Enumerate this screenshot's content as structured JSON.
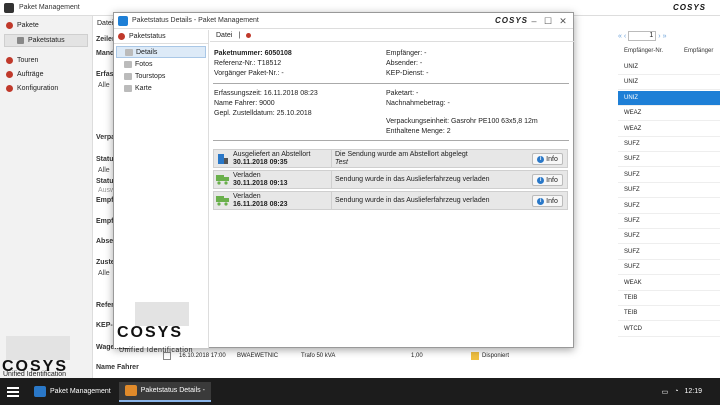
{
  "main_window": {
    "title": "Paket Management",
    "brand": "COSYS",
    "sidebar": {
      "items": [
        {
          "label": "Pakete"
        },
        {
          "label": "Paketstatus"
        },
        {
          "label": "Touren"
        },
        {
          "label": "Aufträge"
        },
        {
          "label": "Konfiguration"
        }
      ],
      "logo": "COSYS",
      "logo_sub": "Unified Identification"
    },
    "content": {
      "tab": "Datei",
      "labels": [
        "Zeilen",
        "Mand",
        "Erfass",
        "Verpa",
        "Status",
        "Alle",
        "Status",
        "Auswe",
        "Empfä",
        "Empfä",
        "Absen",
        "Zuste",
        "Alle",
        "Refere",
        "KEP-D",
        "Wagenbat.",
        "Name Fahrer"
      ],
      "values": [
        "Alle",
        "Alle",
        "Alle",
        "Alle"
      ]
    },
    "table": {
      "page": "1",
      "columns": [
        "Empfänger-Nr.",
        "Empfänger"
      ],
      "rows": [
        "UNIZ",
        "UNIZ",
        "UNIZ",
        "WEAZ",
        "WEAZ",
        "SUFZ",
        "SUFZ",
        "SUFZ",
        "SUFZ",
        "SUFZ",
        "SUFZ",
        "SUFZ",
        "SUFZ",
        "SUFZ",
        "WEAK",
        "TEIB",
        "TEIB",
        "WTCD"
      ],
      "selected_index": 2
    },
    "bottom_row": {
      "date": "16.10.2018 17:00",
      "code": "BWAEWETNIC",
      "desc": "Trafo 50 kVA",
      "amount": "1,00",
      "status": "Disponiert",
      "recipient": "WTCD"
    }
  },
  "dialog": {
    "title": "Paketstatus Details - Paket Management",
    "brand": "COSYS",
    "sidebar_title": "Paketstatus",
    "nav": [
      {
        "label": "Details"
      },
      {
        "label": "Fotos"
      },
      {
        "label": "Tourstops"
      },
      {
        "label": "Karte"
      }
    ],
    "logo": "COSYS",
    "logo_sub": "Unified Identification",
    "toolbar": {
      "file": "Datei",
      "sep": "|"
    },
    "fields": {
      "paketnummer": "Paketnummer: 6050108",
      "referenz": "Referenz-Nr.: T18512",
      "vorgaenger": "Vorgänger Paket-Nr.: -",
      "empfaenger": "Empfänger: -",
      "absender": "Absender: -",
      "kep_dienst": "KEP-Dienst: -",
      "erfassungszeit": "Erfassungszeit: 16.11.2018 08:23",
      "name_fahrer": "Name Fahrer: 9000",
      "zustelldatum": "Gepl. Zustelldatum: 25.10.2018",
      "paketart": "Paketart: -",
      "nachnahme": "Nachnahmebetrag: -",
      "verpackung": "Verpackungseinheit: Gasrohr PE100 63x5,8 12m",
      "menge": "Enthaltene Menge: 2"
    },
    "events": [
      {
        "status": "Ausgeliefert an Abstellort",
        "date": "30.11.2018 09:35",
        "message": "Die Sendung wurde am Abstellort abgelegt",
        "note": "Test",
        "button": "Info",
        "icon": "delivered-icon"
      },
      {
        "status": "Verladen",
        "date": "30.11.2018 09:13",
        "message": "Sendung wurde in das Auslieferfahrzeug verladen",
        "note": "",
        "button": "Info",
        "icon": "truck-icon"
      },
      {
        "status": "Verladen",
        "date": "16.11.2018 08:23",
        "message": "Sendung wurde in das Auslieferfahrzeug verladen",
        "note": "",
        "button": "Info",
        "icon": "truck-icon"
      }
    ]
  },
  "taskbar": {
    "items": [
      {
        "label": "Paket Management"
      },
      {
        "label": "Paketstatus Details -"
      }
    ],
    "time": "12:19"
  },
  "colors": {
    "accent_red": "#c0392b",
    "selection_blue": "#1e7fd6",
    "truck_green": "#6ab04c",
    "taskbar": "#1c1c1c"
  }
}
